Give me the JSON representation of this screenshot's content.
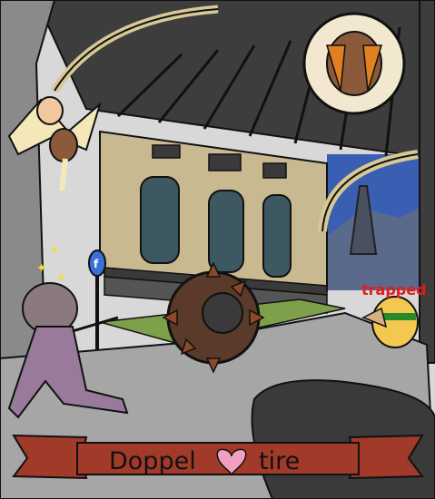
{
  "scene": {
    "title_part1": "Doppel",
    "title_part2": "tire",
    "status_label": "trapped",
    "sign_letter": "f"
  },
  "characters": [
    {
      "name": "bat-winged-creature",
      "pose": "hanging from ceiling"
    },
    {
      "name": "dizzy-fighter",
      "state": "stunned"
    },
    {
      "name": "spiked-tire",
      "state": "rolling"
    },
    {
      "name": "green-striped-creature",
      "state": "trapped"
    },
    {
      "name": "fanged-monster",
      "location": "circular portrait"
    }
  ],
  "colors": {
    "ribbon": "#a23a2a",
    "heart": "#f2a0c0",
    "status_text": "#e31b1b",
    "sky": "#3a5fb2",
    "grass": "#7fa04a"
  }
}
